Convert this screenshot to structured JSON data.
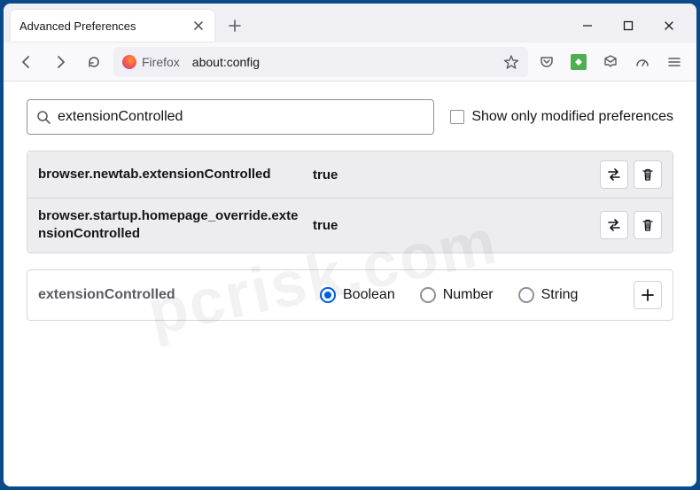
{
  "window": {
    "tab_title": "Advanced Preferences"
  },
  "urlbar": {
    "identity": "Firefox",
    "address": "about:config"
  },
  "search": {
    "value": "extensionControlled",
    "show_modified_label": "Show only modified preferences"
  },
  "prefs": [
    {
      "name": "browser.newtab.extensionControlled",
      "value": "true"
    },
    {
      "name": "browser.startup.homepage_override.extensionControlled",
      "value": "true"
    }
  ],
  "new_pref": {
    "name": "extensionControlled",
    "types": {
      "boolean": "Boolean",
      "number": "Number",
      "string": "String"
    },
    "selected": "boolean"
  }
}
